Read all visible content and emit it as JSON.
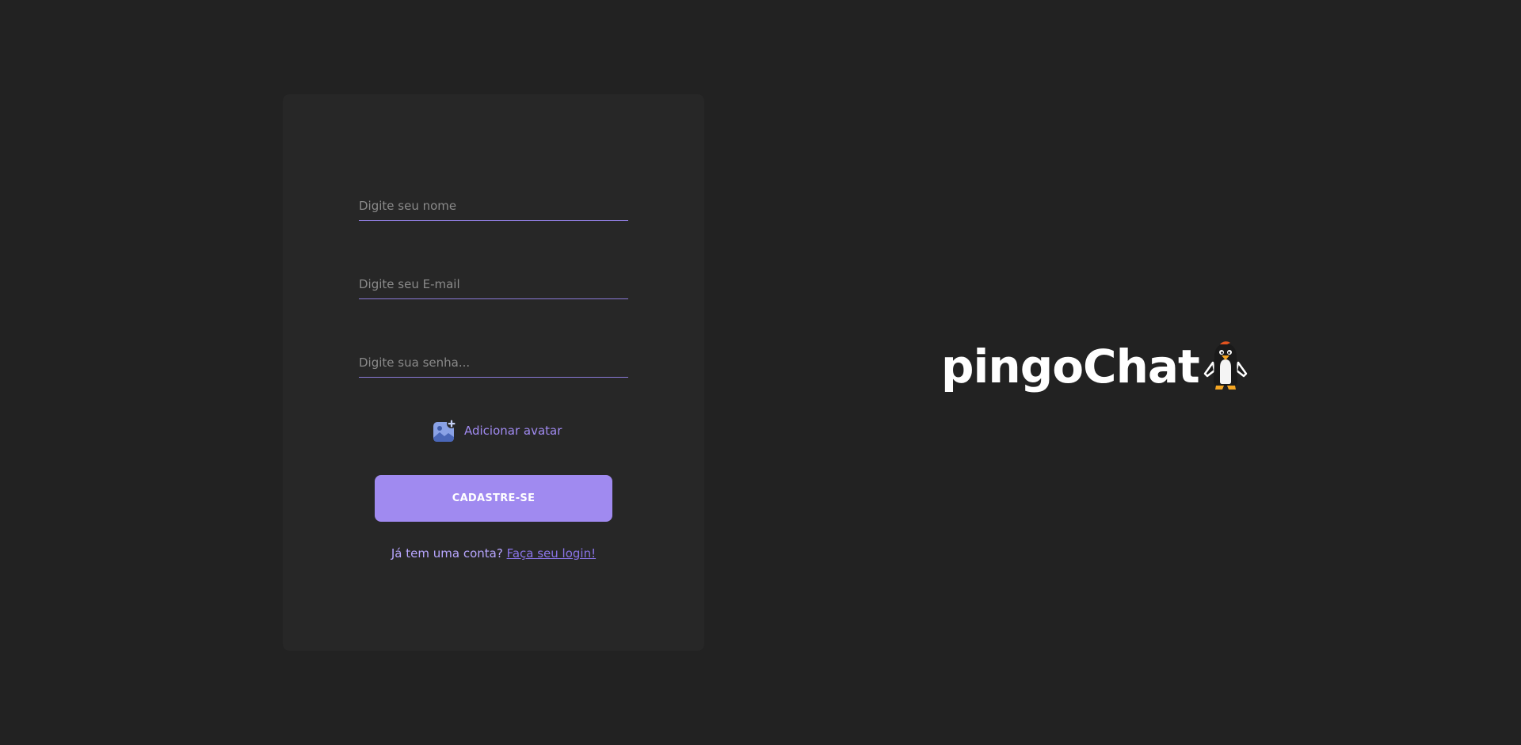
{
  "form": {
    "name_placeholder": "Digite seu nome",
    "email_placeholder": "Digite seu E-mail",
    "password_placeholder": "Digite sua senha...",
    "avatar_label": "Adicionar avatar",
    "submit_label": "CADASTRE-SE",
    "login_prompt": "Já tem uma conta?",
    "login_link": "Faça seu login!"
  },
  "brand": {
    "name": "pingoChat",
    "icon": "penguin-icon"
  },
  "colors": {
    "background": "#222222",
    "card": "#272727",
    "accent": "#a08af0",
    "text": "#ffffff"
  }
}
